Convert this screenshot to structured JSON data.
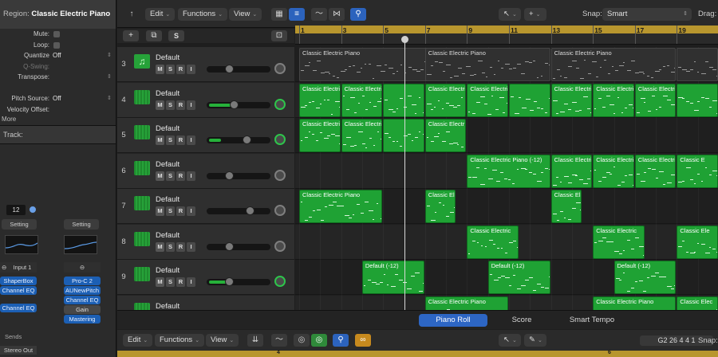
{
  "inspector": {
    "region_label": "Region:",
    "region_name": "Classic Electric Piano",
    "params": [
      {
        "label": "Mute:",
        "value": "",
        "type": "checkbox"
      },
      {
        "label": "Loop:",
        "value": "",
        "type": "checkbox"
      },
      {
        "label": "Quantize",
        "value": "Off",
        "type": "select"
      },
      {
        "label": "Q-Swing:",
        "value": "",
        "type": "dim"
      },
      {
        "label": "Transpose:",
        "value": "",
        "type": "select"
      },
      {
        "label": "",
        "value": "",
        "type": "blank"
      },
      {
        "label": "Pitch Source:",
        "value": "Off",
        "type": "select"
      },
      {
        "label": "Velocity Offset:",
        "value": "",
        "type": "plain"
      }
    ],
    "more": "More",
    "track_label": "Track:",
    "strip_a": {
      "pan_value": "12",
      "setting": "Setting",
      "input": "Input 1",
      "plugins": [
        "ShaperBox",
        "Channel EQ",
        "Channel EQ"
      ],
      "sends": "Sends",
      "output": "Stereo Out"
    },
    "strip_b": {
      "setting": "Setting",
      "plugins": [
        "Pro-C 2",
        "AUNewPitch",
        "Channel EQ",
        "Gain",
        "Mastering"
      ]
    }
  },
  "toolbar": {
    "edit": "Edit",
    "functions": "Functions",
    "view": "View",
    "snap_label": "Snap:",
    "snap_value": "Smart",
    "drag_label": "Drag:"
  },
  "ruler": {
    "bars": [
      "1",
      "3",
      "5",
      "7",
      "9",
      "11",
      "13",
      "15",
      "17",
      "19"
    ]
  },
  "tracks": [
    {
      "num": "3",
      "name": "Default",
      "icon": "note-icon",
      "fader": 0.35,
      "level": 0.0
    },
    {
      "num": "4",
      "name": "Default",
      "icon": "synth-icon",
      "fader": 0.42,
      "level": 0.4
    },
    {
      "num": "5",
      "name": "Default",
      "icon": "synth-icon",
      "fader": 0.62,
      "level": 0.2
    },
    {
      "num": "6",
      "name": "Default",
      "icon": "synth-icon",
      "fader": 0.35,
      "level": 0.0
    },
    {
      "num": "7",
      "name": "Default",
      "icon": "synth-icon",
      "fader": 0.68,
      "level": 0.0
    },
    {
      "num": "8",
      "name": "Default",
      "icon": "synth-icon",
      "fader": 0.35,
      "level": 0.0
    },
    {
      "num": "9",
      "name": "Default",
      "icon": "synth-icon",
      "fader": 0.35,
      "level": 0.3
    },
    {
      "num": "",
      "name": "Default",
      "icon": "synth-icon",
      "fader": 0.35,
      "level": 0.0
    }
  ],
  "regions": [
    {
      "track": 0,
      "start": 1,
      "len": 8,
      "name": "Classic Electric Piano",
      "grey": true
    },
    {
      "track": 0,
      "start": 7,
      "len": 6,
      "name": "Classic Electric Piano",
      "grey": true
    },
    {
      "track": 0,
      "start": 13,
      "len": 6,
      "name": "Classic Electric Piano",
      "grey": true
    },
    {
      "track": 0,
      "start": 19,
      "len": 2,
      "name": "",
      "grey": true
    },
    {
      "track": 1,
      "start": 1,
      "len": 2,
      "name": "Classic Electric Pian",
      "grey": false
    },
    {
      "track": 1,
      "start": 3,
      "len": 2,
      "name": "Classic Electric Piano",
      "grey": false
    },
    {
      "track": 1,
      "start": 5,
      "len": 2,
      "name": "",
      "grey": false
    },
    {
      "track": 1,
      "start": 7,
      "len": 2,
      "name": "Classic Electric",
      "grey": false
    },
    {
      "track": 1,
      "start": 9,
      "len": 2,
      "name": "Classic Electric Piano",
      "grey": false
    },
    {
      "track": 1,
      "start": 11,
      "len": 2,
      "name": "",
      "grey": false
    },
    {
      "track": 1,
      "start": 13,
      "len": 2,
      "name": "Classic Electric",
      "grey": false
    },
    {
      "track": 1,
      "start": 15,
      "len": 2,
      "name": "Classic Electric",
      "grey": false
    },
    {
      "track": 1,
      "start": 17,
      "len": 2,
      "name": "Classic Electric",
      "grey": false
    },
    {
      "track": 1,
      "start": 19,
      "len": 2,
      "name": "",
      "grey": false
    },
    {
      "track": 2,
      "start": 1,
      "len": 2,
      "name": "Classic Electric",
      "grey": false
    },
    {
      "track": 2,
      "start": 3,
      "len": 2,
      "name": "Classic Electric Piano",
      "grey": false
    },
    {
      "track": 2,
      "start": 5,
      "len": 2,
      "name": "",
      "grey": false
    },
    {
      "track": 2,
      "start": 7,
      "len": 2,
      "name": "Classic Electr",
      "grey": false
    },
    {
      "track": 3,
      "start": 9,
      "len": 4,
      "name": "Classic Electric Piano (-12)",
      "grey": false
    },
    {
      "track": 3,
      "start": 13,
      "len": 2,
      "name": "Classic Electric",
      "grey": false
    },
    {
      "track": 3,
      "start": 15,
      "len": 2,
      "name": "Classic Electric",
      "grey": false
    },
    {
      "track": 3,
      "start": 17,
      "len": 2,
      "name": "Classic Electric",
      "grey": false
    },
    {
      "track": 3,
      "start": 19,
      "len": 2,
      "name": "Classic E",
      "grey": false
    },
    {
      "track": 4,
      "start": 1,
      "len": 4,
      "name": "Classic Electric Piano",
      "grey": false
    },
    {
      "track": 4,
      "start": 7,
      "len": 1.5,
      "name": "Classic El",
      "grey": false
    },
    {
      "track": 4,
      "start": 13,
      "len": 1.5,
      "name": "Classic El",
      "grey": false
    },
    {
      "track": 5,
      "start": 9,
      "len": 2.5,
      "name": "Classic Electric",
      "grey": false
    },
    {
      "track": 5,
      "start": 15,
      "len": 2.5,
      "name": "Classic Electric",
      "grey": false
    },
    {
      "track": 5,
      "start": 19,
      "len": 2,
      "name": "Classic Ele",
      "grey": false
    },
    {
      "track": 6,
      "start": 4,
      "len": 3,
      "name": "Default (-12)",
      "grey": false
    },
    {
      "track": 6,
      "start": 10,
      "len": 3,
      "name": "Default (-12)",
      "grey": false
    },
    {
      "track": 6,
      "start": 16,
      "len": 3,
      "name": "Default (-12)",
      "grey": false
    },
    {
      "track": 7,
      "start": 7,
      "len": 4,
      "name": "Classic Electric Piano",
      "grey": false
    },
    {
      "track": 7,
      "start": 15,
      "len": 4,
      "name": "Classic Electric Piano",
      "grey": false
    },
    {
      "track": 7,
      "start": 19,
      "len": 2,
      "name": "Classic Elec",
      "grey": false
    }
  ],
  "editor": {
    "tabs": [
      "Piano Roll",
      "Score",
      "Smart Tempo"
    ],
    "edit": "Edit",
    "functions": "Functions",
    "view": "View",
    "position": "G2  26 4 4 1",
    "snap_label": "Snap:",
    "mini_bars": [
      "4",
      "6"
    ]
  },
  "colors": {
    "accent": "#2d66c4",
    "region_green": "#1fa234",
    "cycle_yellow": "#b8962e"
  }
}
